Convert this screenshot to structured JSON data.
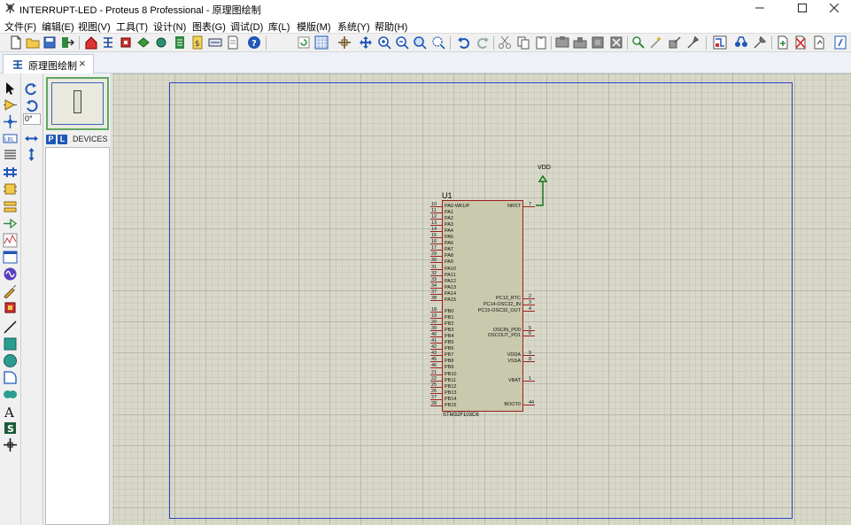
{
  "window": {
    "title": "INTERRUPT-LED - Proteus 8 Professional - 原理图绘制",
    "controls": [
      "minimize",
      "maximize",
      "close"
    ]
  },
  "menu": [
    "文件(F)",
    "编辑(E)",
    "视图(V)",
    "工具(T)",
    "设计(N)",
    "图表(G)",
    "调试(D)",
    "库(L)",
    "模版(M)",
    "系统(Y)",
    "帮助(H)"
  ],
  "toolbar_icons": [
    "new-file-icon",
    "open-folder-icon",
    "save-icon",
    "import-icon",
    "home-icon",
    "schematic-icon",
    "pcb-icon",
    "3d-view-icon",
    "gerber-icon",
    "bom-icon",
    "source-code-icon",
    "design-explorer-icon",
    "help-icon",
    "refresh-icon",
    "grid-icon",
    "origin-icon",
    "pan-icon",
    "zoom-in-icon",
    "zoom-out-icon",
    "zoom-all-icon",
    "zoom-area-icon",
    "undo-icon",
    "redo-icon",
    "cut-icon",
    "copy-icon",
    "paste-icon",
    "block-copy-icon",
    "block-move-icon",
    "block-rotate-icon",
    "block-delete-icon",
    "pick-device-icon",
    "make-device-icon",
    "package-tool-icon",
    "decompose-icon",
    "wire-autorouter-icon",
    "search-tag-icon",
    "property-assign-icon",
    "new-sheet-icon",
    "delete-sheet-icon",
    "exit-to-parent-icon",
    "netlist-to-pcb-icon"
  ],
  "tab": {
    "label": "原理图绘制",
    "close": "×"
  },
  "left_tools": [
    "selection-mode-icon",
    "component-mode-icon",
    "junction-dot-icon",
    "wire-label-icon",
    "text-script-icon",
    "buses-icon",
    "subcircuit-icon",
    "terminals-icon",
    "device-pins-icon",
    "graph-icon",
    "tape-recorder-icon",
    "generator-icon",
    "voltage-probe-icon",
    "current-probe-icon",
    "virtual-instruments-icon",
    "line-2d-icon",
    "box-2d-icon",
    "circle-2d-icon",
    "arc-2d-icon",
    "path-2d-icon",
    "text-2d-icon",
    "symbol-2d-icon",
    "markers-icon"
  ],
  "rotation": {
    "angle": "0°"
  },
  "devices": {
    "badge_p": "P",
    "badge_l": "L",
    "title": "DEVICES"
  },
  "component": {
    "ref": "U1",
    "part": "STM32F103C6",
    "power_label": "VDD",
    "left_pins": [
      {
        "num": "10",
        "name": "PA0-WKUP"
      },
      {
        "num": "11",
        "name": "PA1"
      },
      {
        "num": "12",
        "name": "PA2"
      },
      {
        "num": "13",
        "name": "PA3"
      },
      {
        "num": "14",
        "name": "PA4"
      },
      {
        "num": "15",
        "name": "PA5"
      },
      {
        "num": "16",
        "name": "PA6"
      },
      {
        "num": "17",
        "name": "PA7"
      },
      {
        "num": "29",
        "name": "PA8"
      },
      {
        "num": "30",
        "name": "PA9"
      },
      {
        "num": "31",
        "name": "PA10"
      },
      {
        "num": "32",
        "name": "PA11"
      },
      {
        "num": "33",
        "name": "PA12"
      },
      {
        "num": "34",
        "name": "PA13"
      },
      {
        "num": "37",
        "name": "PA14"
      },
      {
        "num": "38",
        "name": "PA15"
      },
      {
        "num": "18",
        "name": "PB0"
      },
      {
        "num": "19",
        "name": "PB1"
      },
      {
        "num": "20",
        "name": "PB2"
      },
      {
        "num": "39",
        "name": "PB3"
      },
      {
        "num": "40",
        "name": "PB4"
      },
      {
        "num": "41",
        "name": "PB5"
      },
      {
        "num": "42",
        "name": "PB6"
      },
      {
        "num": "43",
        "name": "PB7"
      },
      {
        "num": "45",
        "name": "PB8"
      },
      {
        "num": "46",
        "name": "PB9"
      },
      {
        "num": "21",
        "name": "PB10"
      },
      {
        "num": "22",
        "name": "PB11"
      },
      {
        "num": "25",
        "name": "PB12"
      },
      {
        "num": "26",
        "name": "PB13"
      },
      {
        "num": "27",
        "name": "PB14"
      },
      {
        "num": "28",
        "name": "PB15"
      }
    ],
    "right_pins": [
      {
        "num": "7",
        "name": "NRST"
      },
      {
        "num": "2",
        "name": "PC13_RTC"
      },
      {
        "num": "3",
        "name": "PC14-OSC32_IN"
      },
      {
        "num": "4",
        "name": "PC15-OSC32_OUT"
      },
      {
        "num": "5",
        "name": "OSCIN_PD0"
      },
      {
        "num": "6",
        "name": "OSCOUT_PD1"
      },
      {
        "num": "9",
        "name": "VDDA"
      },
      {
        "num": "8",
        "name": "VSSA"
      },
      {
        "num": "1",
        "name": "VBAT"
      },
      {
        "num": "44",
        "name": "BOOT0"
      }
    ]
  }
}
